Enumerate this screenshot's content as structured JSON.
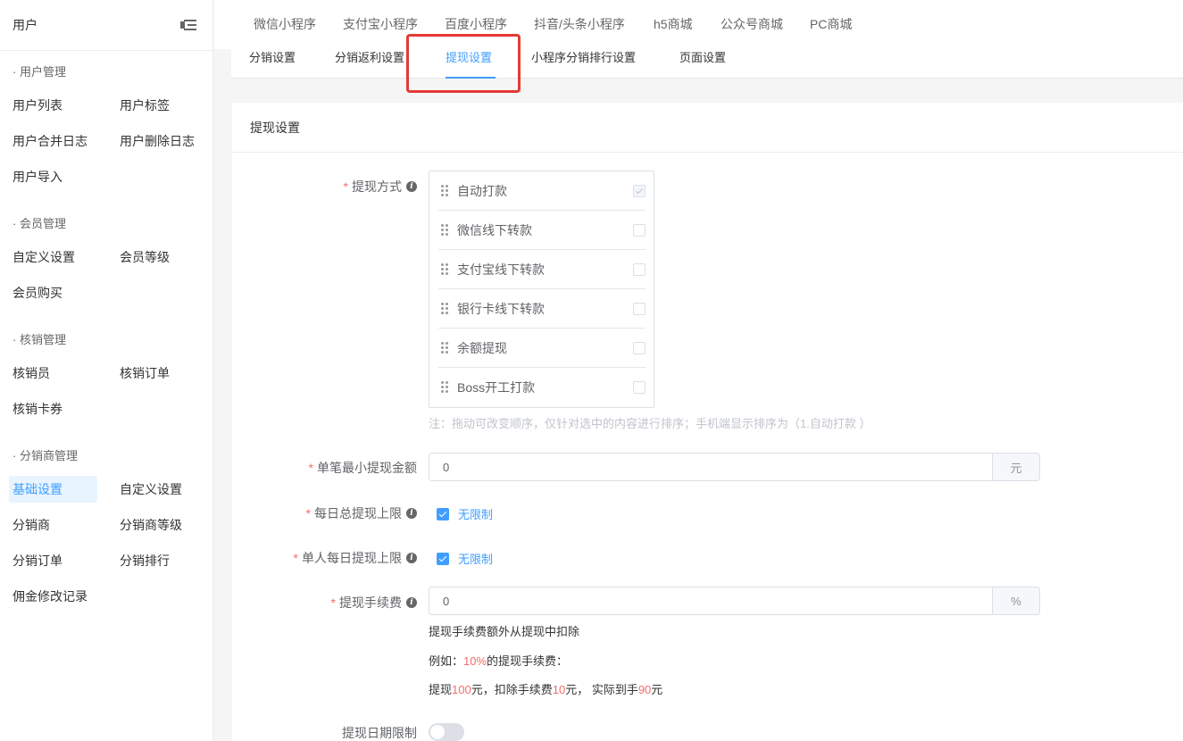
{
  "sidebar": {
    "title": "用户",
    "groups": [
      {
        "title": "· 用户管理",
        "items": [
          "用户列表",
          "用户标签",
          "用户合并日志",
          "用户删除日志",
          "用户导入"
        ]
      },
      {
        "title": "· 会员管理",
        "items": [
          "自定义设置",
          "会员等级",
          "会员购买"
        ]
      },
      {
        "title": "· 核销管理",
        "items": [
          "核销员",
          "核销订单",
          "核销卡券"
        ]
      },
      {
        "title": "· 分销商管理",
        "items": [
          "基础设置",
          "自定义设置",
          "分销商",
          "分销商等级",
          "分销订单",
          "分销排行",
          "佣金修改记录"
        ]
      }
    ],
    "active_item": "基础设置"
  },
  "top_tabs": [
    "微信小程序",
    "支付宝小程序",
    "百度小程序",
    "抖音/头条小程序",
    "h5商城",
    "公众号商城",
    "PC商城"
  ],
  "sub_tabs": [
    "分销设置",
    "分销返利设置",
    "提现设置",
    "小程序分销排行设置",
    "页面设置"
  ],
  "active_sub_tab": "提现设置",
  "accent_color": "#409eff",
  "highlight_color": "#e53935",
  "card": {
    "title": "提现设置",
    "withdraw_method": {
      "label": "提现方式",
      "options": [
        {
          "label": "自动打款",
          "checked": true,
          "disabled": true
        },
        {
          "label": "微信线下转款",
          "checked": false
        },
        {
          "label": "支付宝线下转款",
          "checked": false
        },
        {
          "label": "银行卡线下转款",
          "checked": false
        },
        {
          "label": "余额提现",
          "checked": false
        },
        {
          "label": "Boss开工打款",
          "checked": false
        }
      ],
      "note": "注：拖动可改变顺序，仅针对选中的内容进行排序；手机端显示排序为（1.自动打款 ）"
    },
    "min_amount": {
      "label": "单笔最小提现金额",
      "value": "0",
      "unit": "元"
    },
    "daily_total_limit": {
      "label": "每日总提现上限",
      "checkbox": "无限制"
    },
    "daily_person_limit": {
      "label": "单人每日提现上限",
      "checkbox": "无限制"
    },
    "fee": {
      "label": "提现手续费",
      "value": "0",
      "unit": "%",
      "help1": "提现手续费额外从提现中扣除",
      "help2_prefix": "例如：",
      "help2_red": "10%",
      "help2_suffix": "的提现手续费：",
      "help3_a": "提现",
      "help3_b": "100",
      "help3_c": "元，扣除手续费",
      "help3_d": "10",
      "help3_e": "元， 实际到手",
      "help3_f": "90",
      "help3_g": "元"
    },
    "date_limit": {
      "label": "提现日期限制",
      "enabled": false
    }
  }
}
